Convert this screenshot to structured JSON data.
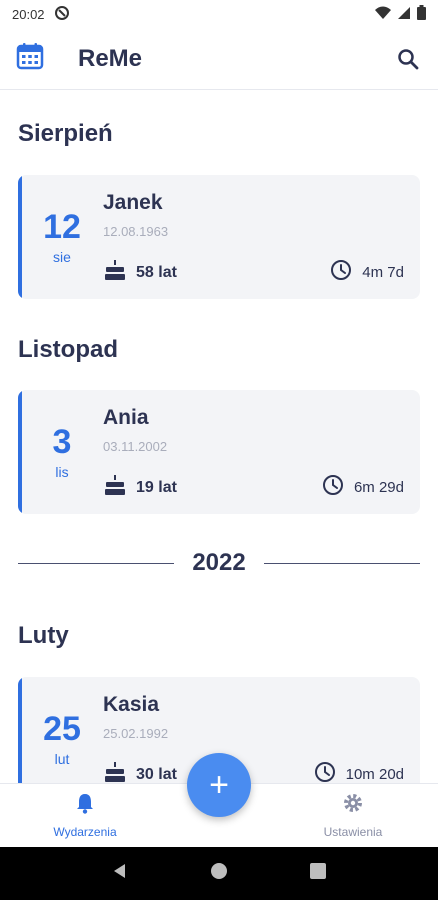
{
  "status_bar": {
    "time": "20:02"
  },
  "app_bar": {
    "title": "ReMe"
  },
  "sections": [
    {
      "month": "Sierpień",
      "card": {
        "day": "12",
        "month_abbr": "sie",
        "name": "Janek",
        "date": "12.08.1963",
        "age": "58 lat",
        "countdown": "4m 7d"
      }
    },
    {
      "month": "Listopad",
      "card": {
        "day": "3",
        "month_abbr": "lis",
        "name": "Ania",
        "date": "03.11.2002",
        "age": "19 lat",
        "countdown": "6m 29d"
      }
    },
    {
      "month": "Luty",
      "card": {
        "day": "25",
        "month_abbr": "lut",
        "name": "Kasia",
        "date": "25.02.1992",
        "age": "30 lat",
        "countdown": "10m 20d"
      }
    }
  ],
  "year_divider": "2022",
  "bottom_nav": {
    "events_label": "Wydarzenia",
    "settings_label": "Ustawienia"
  },
  "fab": {
    "symbol": "+"
  },
  "colors": {
    "accent": "#2f6fe0",
    "fab": "#4a8cf0",
    "card_bg": "#f3f4f7",
    "text_dark": "#2d3352",
    "text_muted": "#a9adbb"
  }
}
